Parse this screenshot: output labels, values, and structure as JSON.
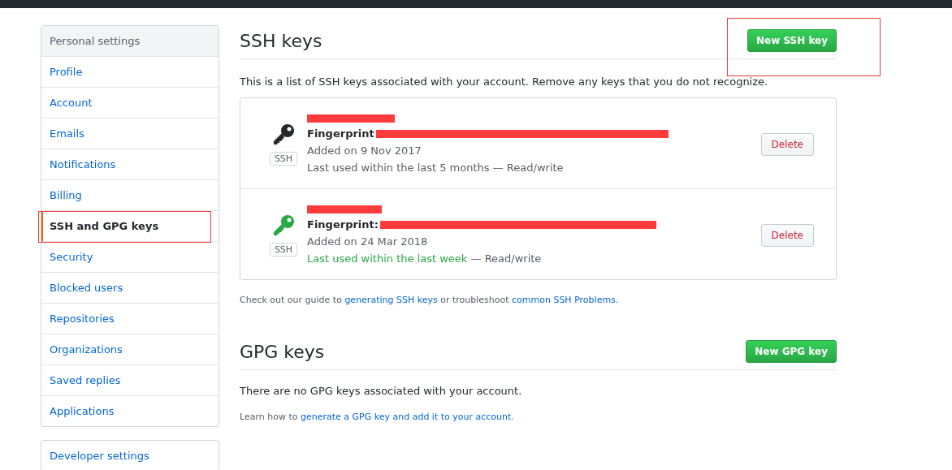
{
  "sidebar": {
    "header": "Personal settings",
    "items": [
      {
        "label": "Profile",
        "selected": false,
        "highlighted": false
      },
      {
        "label": "Account",
        "selected": false,
        "highlighted": false
      },
      {
        "label": "Emails",
        "selected": false,
        "highlighted": false
      },
      {
        "label": "Notifications",
        "selected": false,
        "highlighted": false
      },
      {
        "label": "Billing",
        "selected": false,
        "highlighted": false
      },
      {
        "label": "SSH and GPG keys",
        "selected": true,
        "highlighted": true
      },
      {
        "label": "Security",
        "selected": false,
        "highlighted": false
      },
      {
        "label": "Blocked users",
        "selected": false,
        "highlighted": false
      },
      {
        "label": "Repositories",
        "selected": false,
        "highlighted": false
      },
      {
        "label": "Organizations",
        "selected": false,
        "highlighted": false
      },
      {
        "label": "Saved replies",
        "selected": false,
        "highlighted": false
      },
      {
        "label": "Applications",
        "selected": false,
        "highlighted": false
      }
    ],
    "developer_settings": "Developer settings"
  },
  "ssh": {
    "title": "SSH keys",
    "new_button": {
      "label": "New SSH key",
      "highlighted": true
    },
    "intro": "This is a list of SSH keys associated with your account. Remove any keys that you do not recognize.",
    "keys": [
      {
        "fingerprint_label": "Fingerprint",
        "badge": "SSH",
        "added": "Added on 9 Nov 2017",
        "last_used": "Last used within the last 5 months",
        "access": " — Read/write",
        "recent": false,
        "delete": "Delete"
      },
      {
        "fingerprint_label": "Fingerprint:",
        "badge": "SSH",
        "added": "Added on 24 Mar 2018",
        "last_used": "Last used within the last week",
        "access": " — Read/write",
        "recent": true,
        "delete": "Delete"
      }
    ],
    "help": [
      {
        "text": "Check out our guide to ",
        "link": false
      },
      {
        "text": "generating SSH keys",
        "link": true
      },
      {
        "text": " or troubleshoot ",
        "link": false
      },
      {
        "text": "common SSH Problems.",
        "link": true
      }
    ]
  },
  "gpg": {
    "title": "GPG keys",
    "new_button": {
      "label": "New GPG key",
      "highlighted": false
    },
    "empty": "There are no GPG keys associated with your account.",
    "help": [
      {
        "text": "Learn how to ",
        "link": false
      },
      {
        "text": "generate a GPG key and add it to your account.",
        "link": true
      }
    ]
  }
}
